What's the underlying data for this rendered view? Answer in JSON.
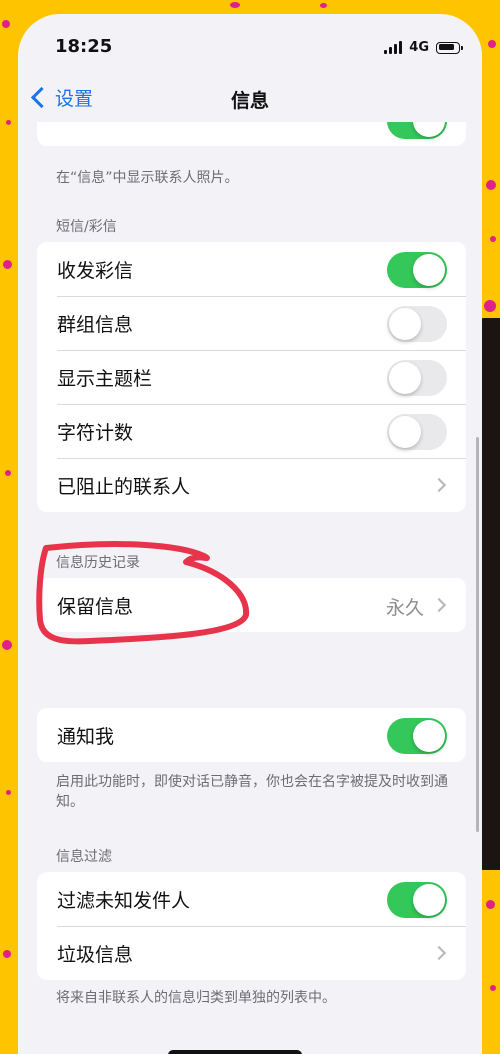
{
  "status_bar": {
    "time": "18:25",
    "network": "4G"
  },
  "nav": {
    "back_label": "设置",
    "title": "信息"
  },
  "top_section": {
    "footer": "在“信息”中显示联系人照片。"
  },
  "sms_section": {
    "header": "短信/彩信",
    "rows": [
      {
        "label": "收发彩信",
        "toggle": "on"
      },
      {
        "label": "群组信息",
        "toggle": "off"
      },
      {
        "label": "显示主题栏",
        "toggle": "off"
      },
      {
        "label": "字符计数",
        "toggle": "off"
      },
      {
        "label": "已阻止的联系人"
      }
    ]
  },
  "history_section": {
    "header": "信息历史记录",
    "keep_messages": {
      "label": "保留信息",
      "value": "永久"
    }
  },
  "notify_section": {
    "row": {
      "label": "通知我",
      "toggle": "on"
    },
    "footer": "启用此功能时，即使对话已静音，你也会在名字被提及时收到通知。"
  },
  "filter_section": {
    "header": "信息过滤",
    "rows": [
      {
        "label": "过滤未知发件人",
        "toggle": "on"
      },
      {
        "label": "垃圾信息"
      }
    ],
    "footer": "将来自非联系人的信息归类到单独的列表中。"
  },
  "colors": {
    "accent": "#1a73e8",
    "toggle_on": "#34c759",
    "annotation": "#e8344b",
    "background": "#ffc400"
  }
}
